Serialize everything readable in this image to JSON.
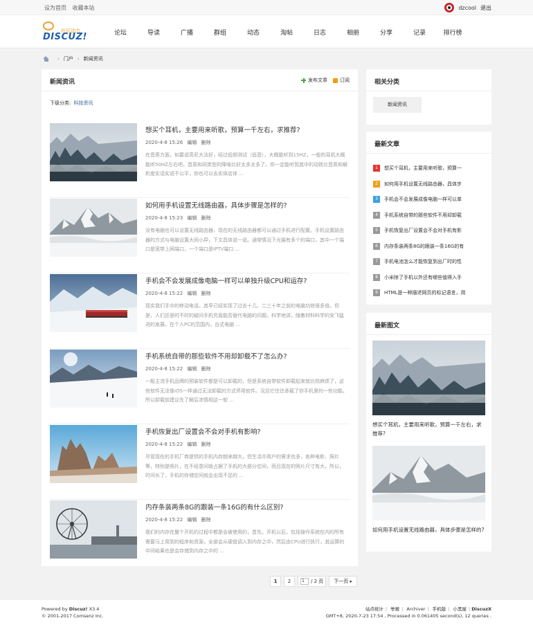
{
  "toolbar": {
    "set_home": "设为首页",
    "bookmark": "收藏本站",
    "username": "dzcool",
    "logout": "退出"
  },
  "logo": {
    "small": "社区动力",
    "big": "DISCUZ!"
  },
  "nav": [
    "论坛",
    "导读",
    "广播",
    "群组",
    "动态",
    "淘帖",
    "日志",
    "相册",
    "分享",
    "记录",
    "排行榜"
  ],
  "breadcrumb": {
    "sep": "›",
    "portal": "门户",
    "current": "新闻资讯"
  },
  "main": {
    "title": "新闻资讯",
    "post_label": "发布文章",
    "subscribe_label": "订阅",
    "subcat_label": "下级分类:",
    "subcat_value": "科技资讯",
    "edit": "编辑",
    "delete": "删除",
    "articles": [
      {
        "title": "想买个耳机，主要用来听歌，预算一千左右，求推荐?",
        "date": "2020-4-8 15:26",
        "summary": "在音质方面，如要说高尼大法好，经过低频测试（低音），大概能听到15HZ，一般的耳机大概能听50HZ左右吧，音质和同类型的降噪比好太多太多了。你一定能听到其中的动铁比音质和解析度实话实说不公平，你也可以去实体店体 ..."
      },
      {
        "title": "如何用手机设置无线路由器，具体步骤是怎样的?",
        "date": "2020-4-8 15:23",
        "summary": "没有电脑也可以设置无线路由器，现在的无线路由器都可以通过手机进行配置。手机设置路由器的方式与电脑设置大同小异，下文具体说一说。通常情况下光猫有多个的端口，其中一个端口是宽带上网端口，一个端口是IPTV端口 ..."
      },
      {
        "title": "手机会不会发展成像电脑一样可以单独升级CPU和运存?",
        "date": "2020-4-8 15:22",
        "summary": "现实我们手中的移动电话，其早已经实现了过去十几、二三十年之前的电脑功效很多倍。但是，人们还是时不时的疑问手机究竟能否替代电脑的问题。科学地讲，随着材料科学的突飞猛进的发展，在个人PC的范围内，台式电脑 ..."
      },
      {
        "title": "手机系统自带的那些软件不用却卸载不了怎么办?",
        "date": "2020-4-8 15:22",
        "summary": "一般主流手机品牌的预装软件都是可以卸载的，但是系统自带软件卸载起来就比较麻烦了，这些软件无法像iOS一样通过无法卸载的方式停用软件。况且它往往承载了你手机里的一些功能。所以卸载前建议先了解后浓情相这一软 ..."
      },
      {
        "title": "手机恢复出厂设置会不会对手机有影响?",
        "date": "2020-4-8 15:22",
        "summary": "尽管现在的手机厂商提供的手机内存越来越大，但生活中用户的需求也多，各种电影、照片等，特别是照片，在不经意间就占据了手机的大部分空间，而且现在的照片尺寸有大。所以，时间长了，手机的存储空间就会出现不足的 ..."
      },
      {
        "title": "内存条装两条8G的跟装一条16G的有什么区别?",
        "date": "2020-4-8 15:22",
        "summary": "我们的内存在整个开机的过程中都是会被使用的，首先，开机以后，包括操作系统在内的所有需要马上用到的程序和资源，全部会从硬盘调入到内存之中，然后由CPU进行执行，其运算的中间结果也是会存储到内存之中的 ..."
      }
    ]
  },
  "pager": {
    "p1": "1",
    "p2": "2",
    "input": "1",
    "total": "/ 2 页",
    "next": "下一页 ▸"
  },
  "sidebar": {
    "related_title": "相关分类",
    "related_btn": "新闻资讯",
    "latest_title": "最新文章",
    "latest": [
      "想买个耳机，主要用来听歌，预算一",
      "如何用手机设置无线路由器，具体步",
      "手机会不会发展成像电脑一样可以单",
      "手机系统自带的那些软件不用却卸载",
      "手机恢复出厂设置会不会对手机有影",
      "内存条装两条8G的跟装一条16G的有",
      "手机电池怎么才能恢复到出厂时的性",
      "小米除了手机以外还有哪些值得入手",
      "HTML是一种描述网页的标记语言，用"
    ],
    "latest_nums": [
      "1",
      "2",
      "3",
      "4",
      "5",
      "6",
      "7",
      "8",
      "9"
    ],
    "pic_title": "最新图文",
    "pics": [
      "想买个耳机，主要用来听歌，预算一千左右，求推荐?",
      "如何用手机设置无线路由器，具体步骤是怎样的?"
    ]
  },
  "footer": {
    "powered": "Powered by",
    "brand": "Discuz!",
    "version": "X3.4",
    "copyright": "© 2001-2017 Comsenz Inc.",
    "links": [
      "站点统计",
      "举报",
      "Archiver",
      "手机版",
      "小黑屋",
      "DiscuzX"
    ],
    "status": "GMT+8, 2020-7-23 17:54 , Processed in 0.061405 second(s), 12 queries ."
  },
  "colors": {
    "accent": "#336699",
    "rank1": "#e5342e",
    "rank2": "#f0a01c",
    "rank3": "#3ca0e0"
  }
}
